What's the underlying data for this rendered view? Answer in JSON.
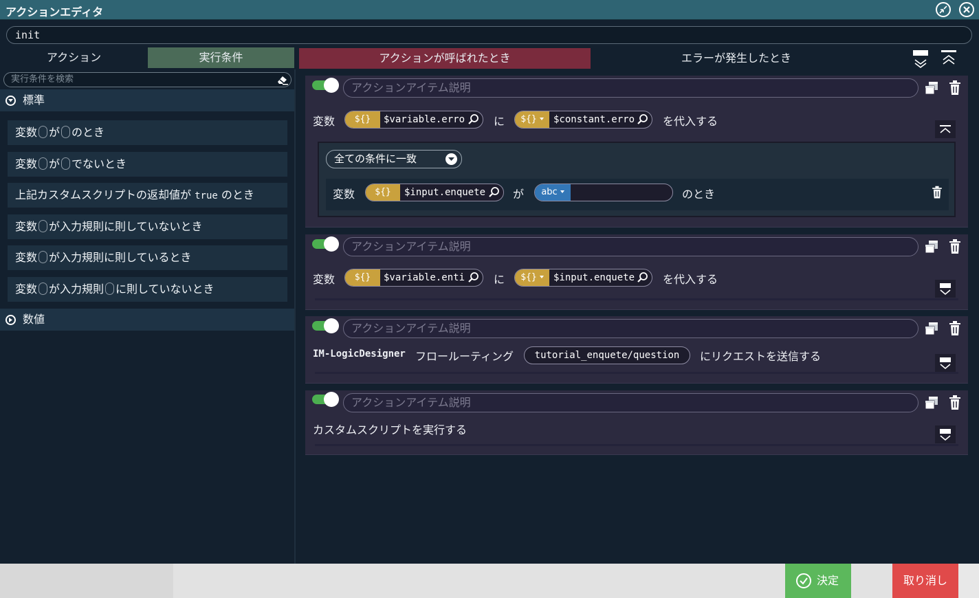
{
  "window": {
    "title": "アクションエディタ"
  },
  "name_field": {
    "value": "init"
  },
  "tabs": {
    "action": "アクション",
    "conditions": "実行条件",
    "on_called": "アクションが呼ばれたとき",
    "on_error": "エラーが発生したとき"
  },
  "left": {
    "search_placeholder": "実行条件を検索",
    "group_standard": "標準",
    "group_numeric": "数値",
    "items": [
      {
        "a": "変数",
        "b": "が",
        "c": "のとき"
      },
      {
        "a": "変数",
        "b": "が",
        "c": "でないとき"
      },
      {
        "a": "上記カスタムスクリプトの返却値が",
        "code": "true",
        "c": "のとき"
      },
      {
        "a": "変数",
        "b": "が入力規則に則していないとき"
      },
      {
        "a": "変数",
        "b": "が入力規則に則しているとき"
      },
      {
        "a": "変数",
        "b": "が入力規則",
        "c": "に則していないとき"
      }
    ]
  },
  "cards": {
    "desc_placeholder": "アクションアイテム説明",
    "card1": {
      "lbl_var": "変数",
      "badge1": "${}",
      "val1": "$variable.erro",
      "ni": "に",
      "badge2": "${}",
      "val2": "$constant.erro",
      "assign": "を代入する",
      "match": "全ての条件に一致",
      "cond_var": "変数",
      "cond_badge": "${}",
      "cond_val": "$input.enquete",
      "ga": "が",
      "type_badge": "abc",
      "tail": "のとき"
    },
    "card2": {
      "lbl_var": "変数",
      "badge1": "${}",
      "val1": "$variable.enti",
      "ni": "に",
      "badge2": "${}",
      "val2": "$input.enquete",
      "assign": "を代入する"
    },
    "card3": {
      "prefix": "IM-LogicDesigner",
      "mid": "フロールーティング",
      "route": "tutorial_enquete/question",
      "suffix": "にリクエストを送信する"
    },
    "card4": {
      "text": "カスタムスクリプトを実行する"
    }
  },
  "footer": {
    "ok": "決定",
    "cancel": "取り消し"
  }
}
